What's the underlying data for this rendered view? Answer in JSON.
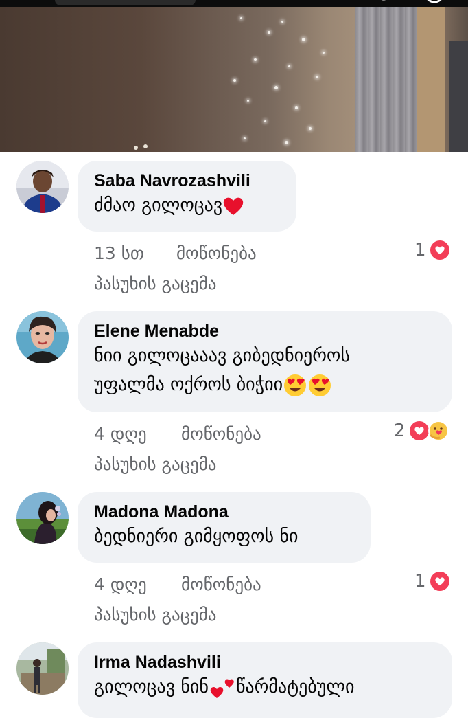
{
  "colors": {
    "bubble_bg": "#f0f2f5",
    "meta_text": "#65676b",
    "love_red": "#f33e58"
  },
  "icons": {
    "video_search": "search-icon",
    "video_more": "more-icon",
    "love": "love-reaction-icon",
    "care": "care-reaction-icon",
    "heart": "red-heart-emoji",
    "heart_eyes": "heart-eyes-emoji"
  },
  "comments": [
    {
      "author": "Saba Navrozashvili",
      "text_lines": [
        "ძმაო გილოცავ"
      ],
      "time": "13 სთ",
      "like_label": "მოწონება",
      "reply_label": "პასუხის გაცემა",
      "reaction_count": "1"
    },
    {
      "author": "Elene Menabde",
      "text_lines": [
        "ნიი გილოცააავ გიბედნიეროს",
        "უფალმა ოქროს ბიჭიი"
      ],
      "time": "4 დღე",
      "like_label": "მოწონება",
      "reply_label": "პასუხის გაცემა",
      "reaction_count": "2"
    },
    {
      "author": "Madona Madona",
      "text_lines": [
        "ბედნიერი გიმყოფოს ნი"
      ],
      "time": "4 დღე",
      "like_label": "მოწონება",
      "reply_label": "პასუხის გაცემა",
      "reaction_count": "1"
    },
    {
      "author": "Irma Nadashvili",
      "text_lines": [
        "გილოცავ ნინ",
        "წარმატებული"
      ]
    }
  ]
}
